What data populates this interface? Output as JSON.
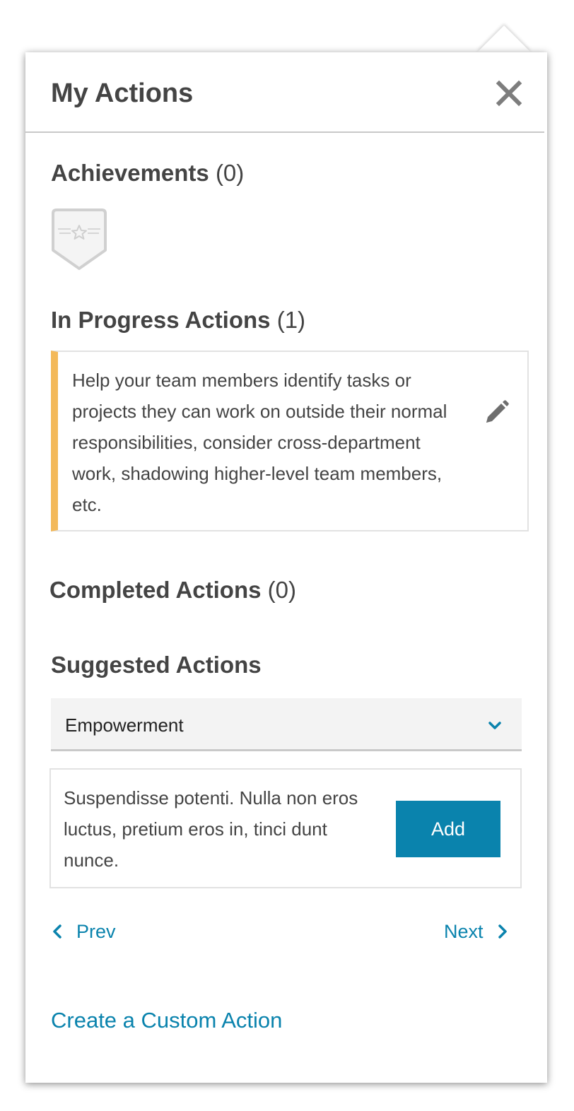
{
  "header": {
    "title": "My Actions",
    "close_icon": "close-icon"
  },
  "achievements": {
    "title": "Achievements",
    "count": "(0)",
    "badge_icon": "badge-star-icon"
  },
  "in_progress": {
    "title": "In Progress Actions",
    "count": "(1)",
    "items": [
      {
        "text": "Help your team members identify tasks or projects they can work on outside their normal responsibilities, consider cross-department work, shadowing higher-level team members, etc.",
        "edit_icon": "pencil-icon"
      }
    ]
  },
  "completed": {
    "title": "Completed Actions",
    "count": "(0)"
  },
  "suggested": {
    "title": "Suggested Actions",
    "category_selected": "Empowerment",
    "items": [
      {
        "text": "Suspendisse potenti. Nulla non eros luctus, pretium eros in, tinci dunt nunce.",
        "button_label": "Add"
      }
    ],
    "prev_label": "Prev",
    "next_label": "Next"
  },
  "custom_action_link": "Create a Custom Action",
  "colors": {
    "accent_blue": "#0a83ad",
    "in_progress_bar": "#f3b95a",
    "heading_text": "#444444"
  }
}
